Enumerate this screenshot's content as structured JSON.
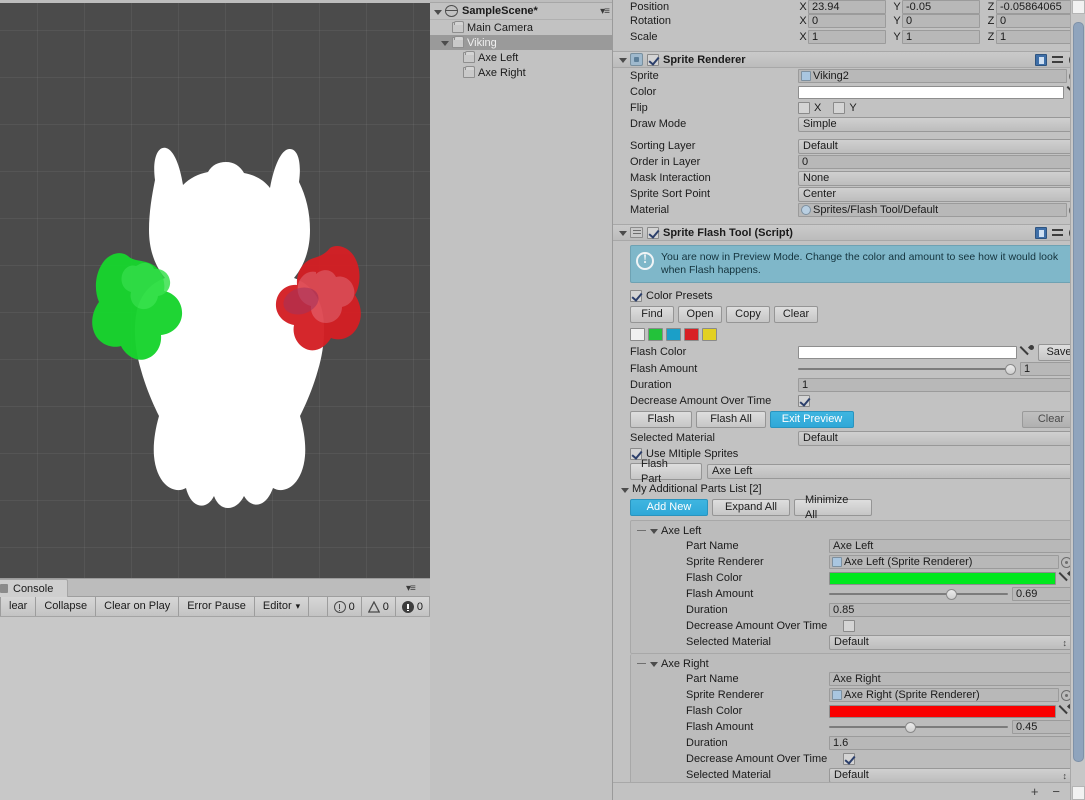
{
  "scene_view": {
    "background_color": "#4b4b4b",
    "sprite_name": "Viking",
    "axe_left_color": "#22c934",
    "axe_right_color": "#d8222a"
  },
  "hierarchy": {
    "scene_name": "SampleScene*",
    "menu_icon": "menu-icon",
    "items": [
      {
        "label": "Main Camera",
        "depth": 1,
        "selected": false,
        "expandable": false
      },
      {
        "label": "Viking",
        "depth": 1,
        "selected": true,
        "expandable": true
      },
      {
        "label": "Axe Left",
        "depth": 2,
        "selected": false,
        "expandable": false
      },
      {
        "label": "Axe Right",
        "depth": 2,
        "selected": false,
        "expandable": false
      }
    ]
  },
  "console": {
    "tab_label": "Console",
    "buttons": [
      "lear",
      "Collapse",
      "Clear on Play",
      "Error Pause",
      "Editor"
    ],
    "clear_label": "lear",
    "collapse_label": "Collapse",
    "clear_on_play_label": "Clear on Play",
    "error_pause_label": "Error Pause",
    "editor_label": "Editor",
    "log_count": "0",
    "warn_count": "0",
    "error_count": "0"
  },
  "transform": {
    "position": {
      "label": "Position",
      "x": "23.94",
      "y": "-0.05",
      "z": "-0.05864065"
    },
    "rotation": {
      "label": "Rotation",
      "x": "0",
      "y": "0",
      "z": "0"
    },
    "scale": {
      "label": "Scale",
      "x": "1",
      "y": "1",
      "z": "1"
    },
    "axis_x": "X",
    "axis_y": "Y",
    "axis_z": "Z"
  },
  "sprite_renderer": {
    "title": "Sprite Renderer",
    "enabled": true,
    "fields": {
      "sprite_label": "Sprite",
      "sprite_value": "Viking2",
      "color_label": "Color",
      "color_value": "#ffffff",
      "flip_label": "Flip",
      "flip_x_label": "X",
      "flip_y_label": "Y",
      "flip_x": false,
      "flip_y": false,
      "draw_mode_label": "Draw Mode",
      "draw_mode_value": "Simple",
      "sorting_layer_label": "Sorting Layer",
      "sorting_layer_value": "Default",
      "order_in_layer_label": "Order in Layer",
      "order_in_layer_value": "0",
      "mask_interaction_label": "Mask Interaction",
      "mask_interaction_value": "None",
      "sprite_sort_point_label": "Sprite Sort Point",
      "sprite_sort_point_value": "Center",
      "material_label": "Material",
      "material_value": "Sprites/Flash Tool/Default"
    }
  },
  "sprite_flash_tool": {
    "title": "Sprite Flash Tool (Script)",
    "enabled": true,
    "help_text": "You are now in Preview Mode. Change the color and amount to see how it would look when Flash happens.",
    "color_presets_label": "Color Presets",
    "color_presets_enabled": true,
    "preset_buttons": [
      "Find",
      "Open",
      "Copy",
      "Clear"
    ],
    "find_label": "Find",
    "open_label": "Open",
    "copy_label": "Copy",
    "clear_preset_label": "Clear",
    "swatches": [
      "#f0f0f0",
      "#23c23a",
      "#1b9fc8",
      "#d81f24",
      "#e2d022"
    ],
    "flash_color_label": "Flash Color",
    "flash_color_value": "#ffffff",
    "save_label": "Save",
    "flash_amount_label": "Flash Amount",
    "flash_amount_value": "1",
    "flash_amount_pct": 100,
    "duration_label": "Duration",
    "duration_value": "1",
    "decrease_label": "Decrease Amount Over Time",
    "decrease_checked": true,
    "flash_label": "Flash",
    "flash_all_label": "Flash All",
    "exit_preview_label": "Exit Preview",
    "clear_label": "Clear",
    "selected_material_label": "Selected Material",
    "selected_material_value": "Default",
    "use_multiple_label": "Use MItiple Sprites",
    "use_multiple_checked": true,
    "flash_part_label": "Flash Part",
    "flash_part_value": "Axe Left",
    "parts_list_title": "My Additional Parts List [2]",
    "add_new_label": "Add New",
    "expand_all_label": "Expand All",
    "minimize_all_label": "Minimize All",
    "parts": [
      {
        "header": "Axe Left",
        "part_name_label": "Part Name",
        "part_name_value": "Axe Left",
        "sprite_renderer_label": "Sprite Renderer",
        "sprite_renderer_value": "Axe Left (Sprite Renderer)",
        "flash_color_label": "Flash Color",
        "flash_color_value": "#00e81e",
        "flash_amount_label": "Flash Amount",
        "flash_amount_value": "0.69",
        "flash_amount_pct": 69,
        "duration_label": "Duration",
        "duration_value": "0.85",
        "decrease_label": "Decrease Amount Over Time",
        "decrease_checked": false,
        "selected_material_label": "Selected Material",
        "selected_material_value": "Default"
      },
      {
        "header": "Axe Right",
        "part_name_label": "Part Name",
        "part_name_value": "Axe Right",
        "sprite_renderer_label": "Sprite Renderer",
        "sprite_renderer_value": "Axe Right (Sprite Renderer)",
        "flash_color_label": "Flash Color",
        "flash_color_value": "#fa0000",
        "flash_amount_label": "Flash Amount",
        "flash_amount_value": "0.45",
        "flash_amount_pct": 45,
        "duration_label": "Duration",
        "duration_value": "1.6",
        "decrease_label": "Decrease Amount Over Time",
        "decrease_checked": true,
        "selected_material_label": "Selected Material",
        "selected_material_value": "Default"
      }
    ]
  },
  "footer": {
    "add_label": "+",
    "remove_label": "−"
  }
}
